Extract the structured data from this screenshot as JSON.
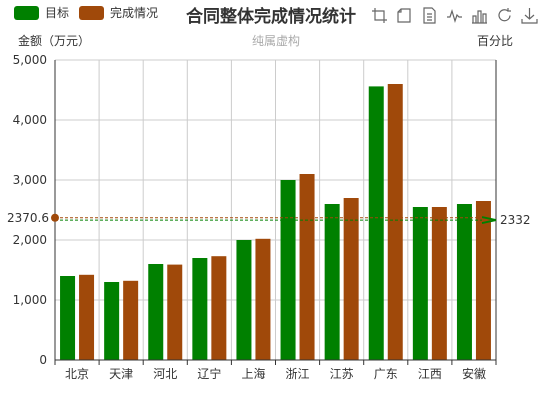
{
  "legend": [
    {
      "label": "目标",
      "color": "#008000"
    },
    {
      "label": "完成情况",
      "color": "#A0490A"
    }
  ],
  "title": "合同整体完成情况统计",
  "subtitle": "纯属虚构",
  "y_axis_name": "金额（万元）",
  "y2_axis_name": "百分比",
  "toolbox": [
    "zoom-select-icon",
    "zoom-reset-icon",
    "data-view-icon",
    "line-chart-icon",
    "bar-chart-icon",
    "restore-icon",
    "save-image-icon"
  ],
  "chart_data": {
    "type": "bar",
    "title": "合同整体完成情况统计",
    "subtitle": "纯属虚构",
    "ylabel": "金额（万元）",
    "y2label": "百分比",
    "categories": [
      "北京",
      "天津",
      "河北",
      "辽宁",
      "上海",
      "浙江",
      "江苏",
      "广东",
      "江西",
      "安徽"
    ],
    "series": [
      {
        "name": "目标",
        "color": "#008000",
        "values": [
          1400,
          1300,
          1600,
          1700,
          2000,
          3000,
          2600,
          4560,
          2550,
          2600
        ]
      },
      {
        "name": "完成情况",
        "color": "#A0490A",
        "values": [
          1420,
          1320,
          1590,
          1730,
          2020,
          3100,
          2700,
          4600,
          2550,
          2650
        ]
      }
    ],
    "ylim": [
      0,
      5000
    ],
    "yticks": [
      0,
      1000,
      2000,
      3000,
      4000,
      5000
    ],
    "ytick_labels": [
      "0",
      "1,000",
      "2,000",
      "3,000",
      "4,000",
      "5,000"
    ],
    "average_lines": [
      {
        "series": "目标",
        "value": 2332,
        "label": "2332",
        "color": "#008000"
      },
      {
        "series": "完成情况",
        "value": 2370.6,
        "label": "2370.6",
        "color": "#A0490A"
      }
    ],
    "grid": true
  }
}
